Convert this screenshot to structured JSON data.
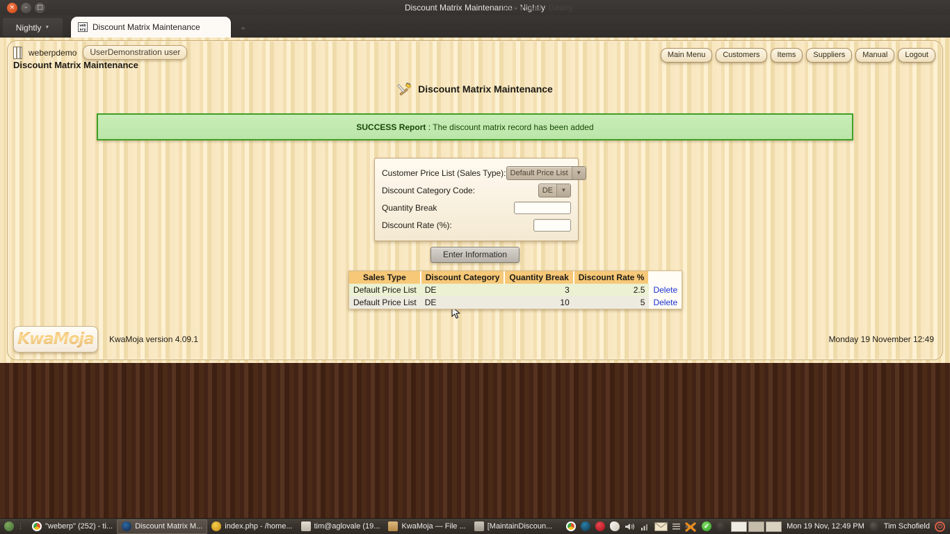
{
  "window": {
    "title": "Discount Matrix Maintenance - Nightly",
    "ghost_title": "New install - Geany",
    "app_menu": "Nightly",
    "tab_label": "Discount Matrix Maintenance",
    "favicon_top": "web",
    "favicon_bottom": "erp",
    "close_glyph": "×",
    "min_glyph": "–",
    "max_glyph": "□",
    "newtab_glyph": "÷"
  },
  "header": {
    "db_name": "weberpdemo",
    "user_pill": "UserDemonstration user",
    "page_title": "Discount Matrix Maintenance",
    "nav": [
      {
        "label": "Main Menu"
      },
      {
        "label": "Customers"
      },
      {
        "label": "Items"
      },
      {
        "label": "Suppliers"
      },
      {
        "label": "Manual"
      },
      {
        "label": "Logout"
      }
    ]
  },
  "main": {
    "heading": "Discount Matrix Maintenance",
    "heading_icon": "tools-icon",
    "message": {
      "label": "SUCCESS Report",
      "separator": " : ",
      "text": "The discount matrix record has been added",
      "type": "success",
      "border_color": "#3f9e26",
      "bg_color": "#c2e9b0"
    },
    "form": {
      "fields": [
        {
          "label": "Customer Price List (Sales Type):",
          "type": "select",
          "value": "Default Price List"
        },
        {
          "label": "Discount Category Code:",
          "type": "select",
          "value": "DE"
        },
        {
          "label": "Quantity Break",
          "type": "text",
          "value": "",
          "placeholder": ""
        },
        {
          "label": "Discount Rate (%):",
          "type": "text",
          "value": "",
          "placeholder": ""
        }
      ],
      "submit_label": "Enter Information"
    },
    "table": {
      "columns": [
        "Sales Type",
        "Discount Category",
        "Quantity Break",
        "Discount Rate %"
      ],
      "rows": [
        {
          "sales_type": "Default Price List",
          "discount_category": "DE",
          "quantity_break": "3",
          "discount_rate": "2.5",
          "action": "Delete"
        },
        {
          "sales_type": "Default Price List",
          "discount_category": "DE",
          "quantity_break": "10",
          "discount_rate": "5",
          "action": "Delete"
        }
      ]
    }
  },
  "footer": {
    "logo_text": "KwaMoja",
    "version": "KwaMoja version 4.09.1",
    "datestamp": "Monday 19 November 12:49"
  },
  "taskbar": {
    "items": [
      {
        "name": "firefox-window",
        "label": "\"weberp\" (252) - ti...",
        "icon": "chrome-icon",
        "color": "#d9532c",
        "active": false
      },
      {
        "name": "discount-matrix-window",
        "label": "Discount Matrix M...",
        "icon": "nightly-icon",
        "color": "#1d3b66",
        "active": true
      },
      {
        "name": "index-php-window",
        "label": "index.php - /home...",
        "icon": "geany-icon",
        "color": "#e8b230",
        "active": false
      },
      {
        "name": "terminal-window",
        "label": "tim@aglovale (19...",
        "icon": "terminal-icon",
        "color": "#cfcabb",
        "active": false
      },
      {
        "name": "files-window",
        "label": "KwaMoja — File ...",
        "icon": "folder-icon",
        "color": "#c39a5c",
        "active": false
      },
      {
        "name": "maintain-discount-window",
        "label": "[MaintainDiscoun...",
        "icon": "window-icon",
        "color": "#b4ad9f",
        "active": false
      }
    ],
    "tray_icons": [
      {
        "name": "chrome-tray-icon",
        "color": "#3ba347"
      },
      {
        "name": "browser-tray-icon",
        "color": "#1c5a78"
      },
      {
        "name": "opera-tray-icon",
        "color": "#d0202a"
      },
      {
        "name": "dropbox-tray-icon",
        "color": "#eeeae2"
      },
      {
        "name": "volume-icon",
        "color": "#d8d3cb"
      },
      {
        "name": "network-icon",
        "color": "#d8d3cb"
      },
      {
        "name": "mail-icon",
        "color": "#e6d8be"
      },
      {
        "name": "menu-icon",
        "color": "#cfc9c0"
      },
      {
        "name": "update-icon",
        "color": "#e98c1f"
      },
      {
        "name": "checkmark-icon",
        "color": "#56c243"
      },
      {
        "name": "dark-circle-icon",
        "color": "#3b3631"
      }
    ],
    "workspaces": [
      {
        "name": "workspace-1",
        "active": true
      },
      {
        "name": "workspace-2",
        "active": false
      },
      {
        "name": "workspace-3",
        "active": false
      }
    ],
    "clock": "Mon 19 Nov, 12:49 PM",
    "username": "Tim Schofield",
    "power_glyph": "⏻"
  }
}
